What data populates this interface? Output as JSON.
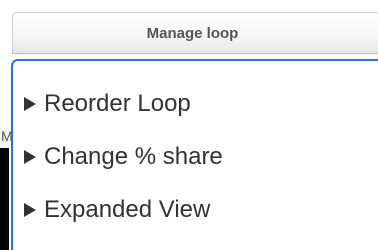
{
  "header": {
    "manage_button_label": "Manage loop"
  },
  "background": {
    "partial_text": "M"
  },
  "menu": {
    "items": [
      {
        "label": "Reorder Loop",
        "icon": "triangle-right-icon"
      },
      {
        "label": "Change % share",
        "icon": "triangle-right-icon"
      },
      {
        "label": "Expanded View",
        "icon": "triangle-right-icon"
      }
    ]
  },
  "colors": {
    "panel_border": "#2d73c7",
    "text": "#333333",
    "button_text": "#555555"
  }
}
